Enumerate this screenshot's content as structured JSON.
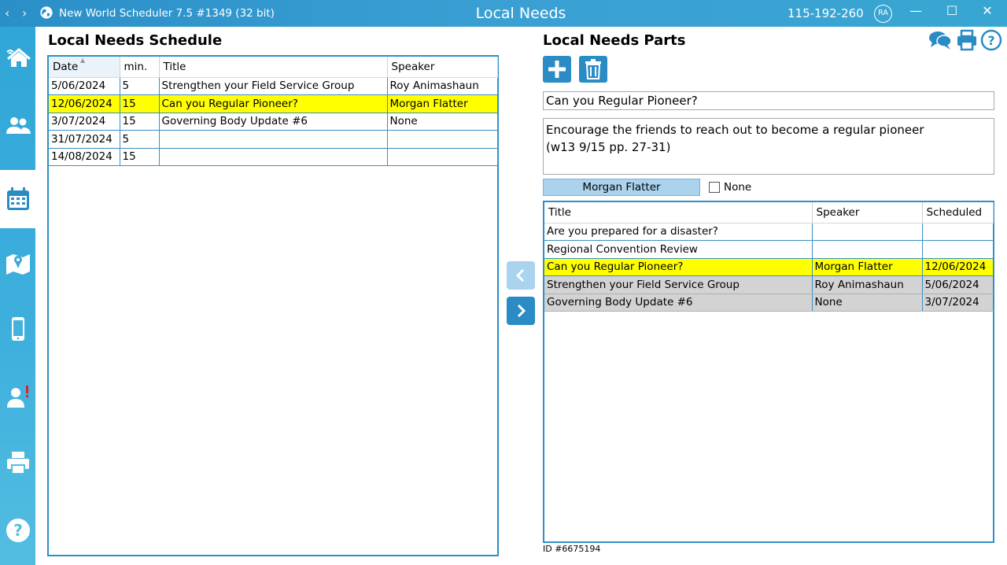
{
  "window": {
    "app_title": "New World Scheduler 7.5 #1349 (32 bit)",
    "section_title": "Local Needs",
    "code": "115-192-260",
    "user_initials": "RA",
    "nav_back": "‹",
    "nav_forward": "›",
    "minimize": "—",
    "maximize": "☐",
    "close": "✕"
  },
  "sidebar": {
    "items": [
      {
        "name": "home",
        "icon": "home-wifi-icon"
      },
      {
        "name": "people",
        "icon": "people-icon"
      },
      {
        "name": "calendar",
        "icon": "calendar-icon",
        "active": true
      },
      {
        "name": "map",
        "icon": "map-icon"
      },
      {
        "name": "mobile",
        "icon": "mobile-icon"
      },
      {
        "name": "user-alert",
        "icon": "user-alert-icon"
      },
      {
        "name": "print",
        "icon": "printer-icon"
      },
      {
        "name": "help",
        "icon": "help-icon"
      }
    ]
  },
  "schedule": {
    "heading": "Local Needs Schedule",
    "columns": [
      "Date",
      "min.",
      "Title",
      "Speaker"
    ],
    "rows": [
      {
        "date": "5/06/2024",
        "min": "5",
        "title": "Strengthen your Field Service Group",
        "speaker": "Roy Animashaun",
        "selected": false
      },
      {
        "date": "12/06/2024",
        "min": "15",
        "title": "Can you Regular Pioneer?",
        "speaker": "Morgan Flatter",
        "selected": true
      },
      {
        "date": "3/07/2024",
        "min": "15",
        "title": "Governing Body Update #6",
        "speaker": "None",
        "selected": false
      },
      {
        "date": "31/07/2024",
        "min": "5",
        "title": "",
        "speaker": "",
        "selected": false
      },
      {
        "date": "14/08/2024",
        "min": "15",
        "title": "",
        "speaker": "",
        "selected": false
      }
    ]
  },
  "parts": {
    "heading": "Local Needs Parts",
    "add_icon": "plus-icon",
    "delete_icon": "trash-icon",
    "title_value": "Can you Regular Pioneer?",
    "description_line1": "Encourage the friends to reach out to become a regular pioneer",
    "description_line2": "(w13 9/15 pp. 27-31)",
    "speaker_button": "Morgan Flatter",
    "none_label": "None",
    "none_checked": false,
    "columns": [
      "Title",
      "Speaker",
      "Scheduled"
    ],
    "rows": [
      {
        "title": "Are you prepared for a disaster?",
        "speaker": "",
        "scheduled": "",
        "state": "normal"
      },
      {
        "title": "Regional Convention Review",
        "speaker": "",
        "scheduled": "",
        "state": "normal"
      },
      {
        "title": "Can you Regular Pioneer?",
        "speaker": "Morgan Flatter",
        "scheduled": "12/06/2024",
        "state": "selected"
      },
      {
        "title": "Strengthen your Field Service Group",
        "speaker": "Roy Animashaun",
        "scheduled": "5/06/2024",
        "state": "grey"
      },
      {
        "title": "Governing Body Update #6",
        "speaker": "None",
        "scheduled": "3/07/2024",
        "state": "grey"
      }
    ],
    "id_text": "ID #6675194"
  },
  "colors": {
    "accent": "#2b8cc5",
    "selection": "#ffff00",
    "scheduled_row": "#d3d3d3"
  }
}
